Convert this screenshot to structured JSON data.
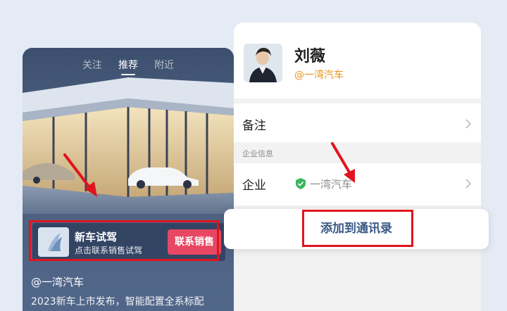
{
  "feed": {
    "tabs": [
      {
        "label": "关注",
        "active": false
      },
      {
        "label": "推荐",
        "active": true
      },
      {
        "label": "附近",
        "active": false
      }
    ],
    "promo": {
      "title": "新车试驾",
      "subtitle": "点击联系销售试驾",
      "button_label": "联系销售",
      "logo_icon": "sail-logo-icon"
    },
    "author": "@一湾汽车",
    "description": "2023新车上市发布，智能配置全系标配"
  },
  "contact": {
    "name": "刘薇",
    "company_tag": "@一湾汽车",
    "remark_label": "备注",
    "section_label": "企业信息",
    "company_label": "企业",
    "company_value": "一湾汽车",
    "verified_icon": "shield-check-icon",
    "add_button_label": "添加到通讯录"
  },
  "colors": {
    "accent_red": "#e0141e",
    "promo_button": "#e74763",
    "company_tag": "#e8931c",
    "add_button_text": "#3a5a86",
    "verified_green": "#3cb55f"
  }
}
